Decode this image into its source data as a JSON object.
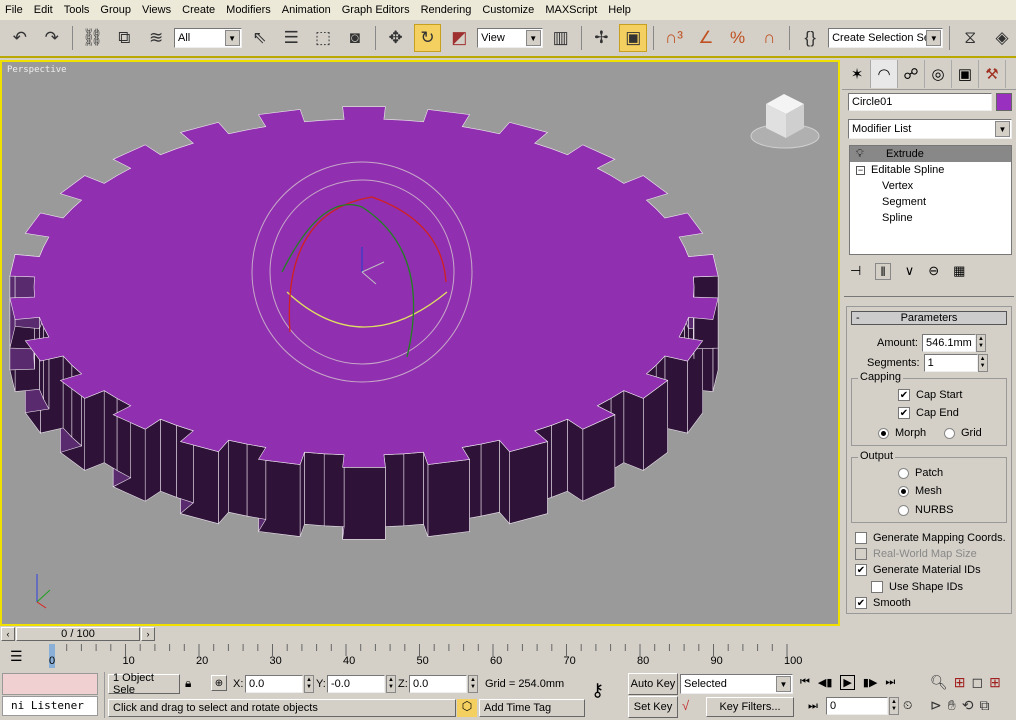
{
  "menu": [
    "File",
    "Edit",
    "Tools",
    "Group",
    "Views",
    "Create",
    "Modifiers",
    "Animation",
    "Graph Editors",
    "Rendering",
    "Customize",
    "MAXScript",
    "Help"
  ],
  "toolbar": {
    "selection_filter": "All",
    "ref_coord": "View",
    "named_selection": "Create Selection Set"
  },
  "viewport": {
    "label": "Perspective",
    "object_color": "#9030b0",
    "background": "#9a9a9a",
    "active_border": "#f0e000"
  },
  "panel": {
    "object_name": "Circle01",
    "object_color": "#9a30c0",
    "modifier_list": "Modifier List",
    "stack": [
      {
        "label": "Extrude",
        "selected": true
      },
      {
        "label": "Editable Spline"
      },
      {
        "label": "Vertex"
      },
      {
        "label": "Segment"
      },
      {
        "label": "Spline"
      }
    ],
    "params": {
      "title": "Parameters",
      "collapse": "-",
      "amount_label": "Amount:",
      "amount": "546.1mm",
      "segments_label": "Segments:",
      "segments": "1",
      "capping": {
        "label": "Capping",
        "cap_start": "Cap Start",
        "cap_end": "Cap End",
        "morph": "Morph",
        "grid": "Grid"
      },
      "output": {
        "label": "Output",
        "patch": "Patch",
        "mesh": "Mesh",
        "nurbs": "NURBS"
      },
      "gen_mapping": "Generate Mapping Coords.",
      "real_world": "Real-World Map Size",
      "gen_mat_ids": "Generate Material IDs",
      "use_shape_ids": "Use Shape IDs",
      "smooth": "Smooth"
    }
  },
  "timeline": {
    "slider": "0 / 100",
    "ticks": [
      "0",
      "10",
      "20",
      "30",
      "40",
      "50",
      "60",
      "70",
      "80",
      "90",
      "100"
    ]
  },
  "status": {
    "listener": "ni Listener",
    "selection": "1 Object Sele",
    "x_label": "X:",
    "x": "0.0",
    "y_label": "Y:",
    "y": "-0.0",
    "z_label": "Z:",
    "z": "0.0",
    "grid": "Grid = 254.0mm",
    "prompt": "Click and drag to select and rotate objects",
    "add_time_tag": "Add Time Tag",
    "auto_key": "Auto Key",
    "set_key": "Set Key",
    "key_mode": "Selected",
    "key_filters": "Key Filters...",
    "frame": "0"
  }
}
